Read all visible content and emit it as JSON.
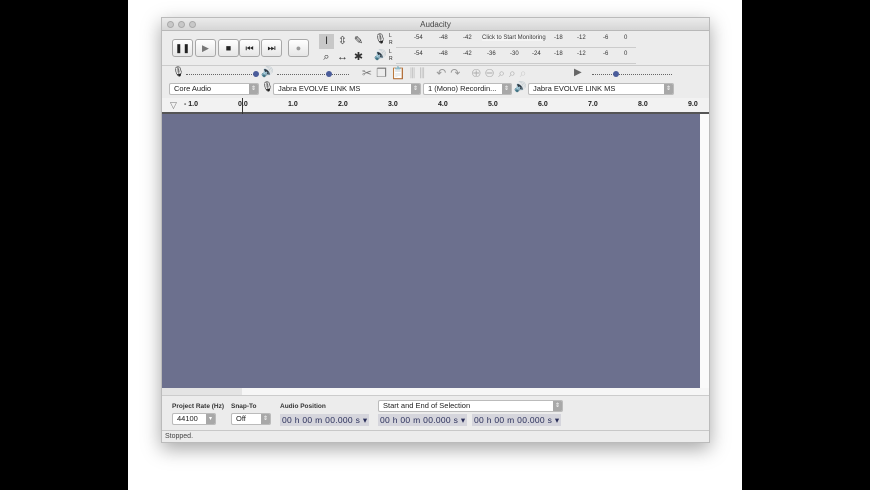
{
  "window": {
    "title": "Audacity"
  },
  "transport": {
    "pause": "❚❚",
    "play": "▶",
    "stop": "■",
    "skip_start": "⏮",
    "skip_end": "⏭",
    "record": "●"
  },
  "tools": [
    "I",
    "⇳",
    "✎",
    "⌕",
    "↔",
    "✱"
  ],
  "meters": {
    "record_labels": [
      "-54",
      "-48",
      "-42",
      "-18",
      "-12",
      "-6",
      "0"
    ],
    "monitor_text": "Click to Start Monitoring",
    "playback_labels": [
      "-54",
      "-48",
      "-42",
      "-36",
      "-30",
      "-24",
      "-18",
      "-12",
      "-6",
      "0"
    ],
    "channels": [
      "L",
      "R"
    ]
  },
  "mixer": {
    "minus": "-",
    "plus": "+"
  },
  "devices": {
    "host": "Core Audio",
    "recording_device": "Jabra EVOLVE LINK MS",
    "channels": "1 (Mono) Recordin...",
    "playback_device": "Jabra EVOLVE LINK MS"
  },
  "ruler": {
    "ticks": [
      "- 1.0",
      "0.0",
      "1.0",
      "2.0",
      "3.0",
      "4.0",
      "5.0",
      "6.0",
      "7.0",
      "8.0",
      "9.0"
    ]
  },
  "track_color": "#6c708e",
  "selection": {
    "project_rate_label": "Project Rate (Hz)",
    "project_rate": "44100",
    "snap_label": "Snap-To",
    "snap": "Off",
    "audio_position_label": "Audio Position",
    "audio_position": "00 h 00 m 00.000 s",
    "selection_mode": "Start and End of Selection",
    "start": "00 h 00 m 00.000 s",
    "end": "00 h 00 m 00.000 s"
  },
  "status": "Stopped."
}
